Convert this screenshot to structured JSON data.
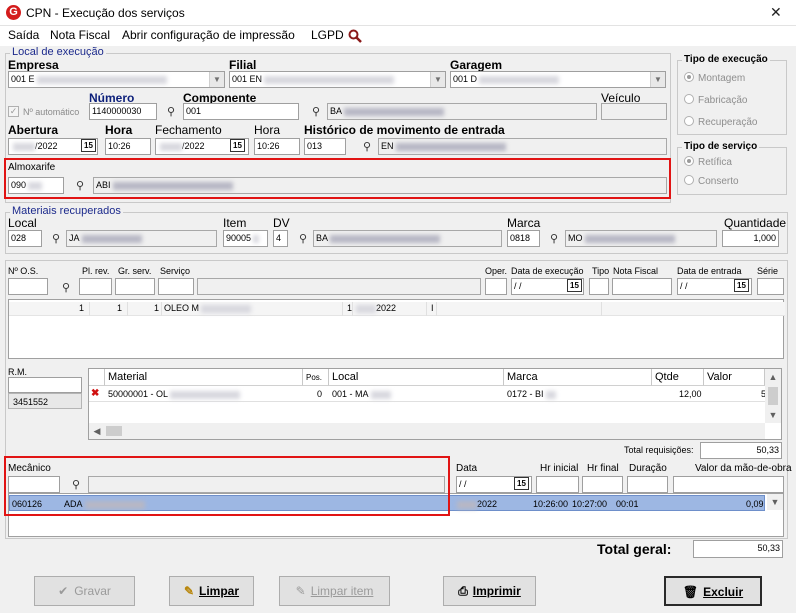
{
  "window": {
    "title": "CPN - Execução dos serviços",
    "close_label": "✕"
  },
  "menu": {
    "items": [
      "Saída",
      "Nota Fiscal",
      "Abrir configuração de impressão",
      "LGPD"
    ]
  },
  "local_exec": {
    "title": "Local de execução",
    "empresa_label": "Empresa",
    "empresa_value": "001 E",
    "filial_label": "Filial",
    "filial_value": "001 EN",
    "garagem_label": "Garagem",
    "garagem_value": "001 D",
    "auto_label": "Nº automático",
    "numero_label": "Número",
    "numero_value": "1140000030",
    "componente_label": "Componente",
    "componente_code": "001",
    "componente_desc": "BA",
    "veiculo_label": "Veículo",
    "abertura_label": "Abertura",
    "abertura_value": "/2022",
    "hora1_label": "Hora",
    "hora1_value": "10:26",
    "fechamento_label": "Fechamento",
    "fechamento_value": "/2022",
    "hora2_label": "Hora",
    "hora2_value": "10:26",
    "historico_label": "Histórico de movimento de entrada",
    "historico_code": "013",
    "historico_desc": "EN",
    "almox_label": "Almoxarife",
    "almox_code": "090",
    "almox_desc": "ABI"
  },
  "tipo_exec": {
    "title": "Tipo de execução",
    "options": [
      "Montagem",
      "Fabricação",
      "Recuperação"
    ]
  },
  "tipo_serv": {
    "title": "Tipo de serviço",
    "options": [
      "Retífica",
      "Conserto"
    ]
  },
  "cal_icon_text": "15",
  "mat_rec": {
    "title": "Materiais recuperados",
    "local_label": "Local",
    "local_code": "028",
    "local_desc": "JA",
    "item_label": "Item",
    "item_value": "90005",
    "dv_label": "DV",
    "dv_value": "4",
    "item_desc": "BA",
    "marca_label": "Marca",
    "marca_code": "0818",
    "marca_desc": "MO",
    "qtd_label": "Quantidade",
    "qtd_value": "1,000"
  },
  "os": {
    "headers": [
      "Nº O.S.",
      "Pl. rev.",
      "Gr. serv.",
      "Serviço",
      "Oper.",
      "Data de execução",
      "Tipo",
      "Nota Fiscal",
      "Data de entrada",
      "Série"
    ],
    "date_empty": "/ /",
    "row": [
      "1",
      "1",
      "1",
      "OLEO M",
      "1",
      "2022",
      "I"
    ]
  },
  "rm": {
    "label": "R.M.",
    "value": "3451552"
  },
  "materials": {
    "headers": [
      "Material",
      "Pos.",
      "Local",
      "Marca",
      "Qtde",
      "Valor"
    ],
    "row": {
      "material": "50000001 - OL",
      "pos": "0",
      "local": "001 - MA",
      "marca": "0172 - BI",
      "qtde": "12,00",
      "valor": "5"
    },
    "total_label": "Total requisições:",
    "total_value": "50,33"
  },
  "mecanico": {
    "label": "Mecânico",
    "headers": [
      "Data",
      "Hr inicial",
      "Hr final",
      "Duração",
      "Valor da mão-de-obra"
    ],
    "date_empty": "/ /",
    "row": {
      "code": "060126",
      "name": "ADA",
      "data": "2022",
      "hi": "10:26:00",
      "hf": "10:27:00",
      "dur": "00:01",
      "valor": "0,09"
    }
  },
  "total_geral": {
    "label": "Total geral:",
    "value": "50,33"
  },
  "buttons": {
    "gravar": "Gravar",
    "limpar": "Limpar",
    "limpar_item": "Limpar item",
    "imprimir": "Imprimir",
    "excluir": "Excluir"
  }
}
